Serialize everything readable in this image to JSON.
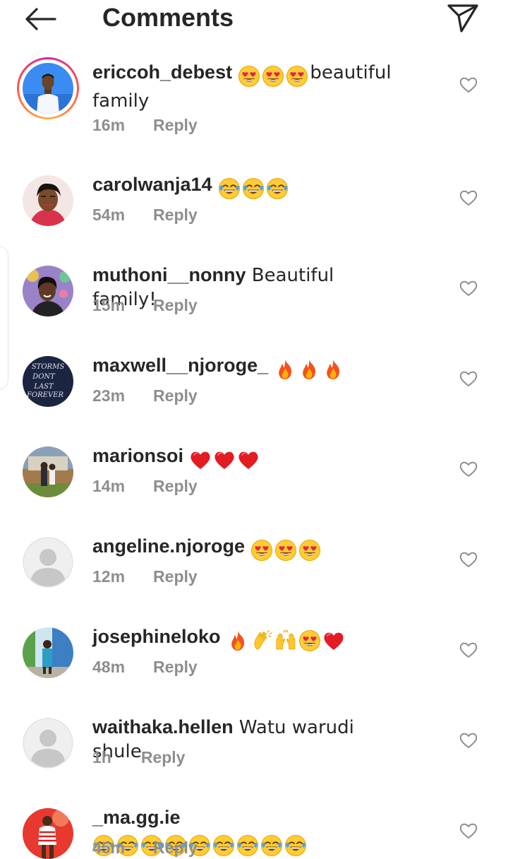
{
  "header": {
    "title": "Comments",
    "back_icon": "arrow-left-icon",
    "share_icon": "paper-plane-icon"
  },
  "comments": [
    {
      "username": "ericcoh_debest",
      "text": "beautiful family",
      "emojis": [
        "heart-eyes",
        "heart-eyes",
        "heart-eyes"
      ],
      "emoji_position": "before",
      "time": "16m",
      "reply": "Reply",
      "avatar": "photo-man-blue",
      "story_ring": true
    },
    {
      "username": "carolwanja14",
      "text": "",
      "emojis": [
        "tears-of-joy",
        "tears-of-joy",
        "tears-of-joy"
      ],
      "time": "54m",
      "reply": "Reply",
      "avatar": "photo-woman-selfie"
    },
    {
      "username": "muthoni__nonny",
      "text": "Beautiful family!",
      "emojis": [],
      "time": "15m",
      "reply": "Reply",
      "avatar": "photo-woman-purple"
    },
    {
      "username": "maxwell__njoroge_",
      "text": "",
      "emojis": [
        "fire",
        "fire",
        "fire"
      ],
      "time": "23m",
      "reply": "Reply",
      "avatar": "text-storms-dont-last-forever",
      "avatar_text": [
        "STORMS",
        "DONT",
        "LAST",
        "FOREVER"
      ]
    },
    {
      "username": "marionsoi",
      "text": "",
      "emojis": [
        "red-heart",
        "red-heart",
        "red-heart"
      ],
      "time": "14m",
      "reply": "Reply",
      "avatar": "photo-outdoor-people"
    },
    {
      "username": "angeline.njoroge",
      "text": "",
      "emojis": [
        "heart-eyes",
        "heart-eyes",
        "heart-eyes"
      ],
      "time": "12m",
      "reply": "Reply",
      "avatar": "default-avatar"
    },
    {
      "username": "josephineloko",
      "text": "",
      "emojis": [
        "fire",
        "clapping-hands",
        "raising-hands",
        "heart-eyes",
        "red-heart"
      ],
      "time": "48m",
      "reply": "Reply",
      "avatar": "photo-outdoor-woman"
    },
    {
      "username": "waithaka.hellen",
      "text": "Watu warudi shule",
      "emojis": [],
      "time": "1h",
      "reply": "Reply",
      "avatar": "default-avatar"
    },
    {
      "username": "_ma.gg.ie",
      "text": "",
      "emojis": [
        "tears-of-joy",
        "tears-of-joy",
        "tears-of-joy",
        "tears-of-joy",
        "tears-of-joy",
        "tears-of-joy",
        "tears-of-joy",
        "tears-of-joy",
        "tears-of-joy"
      ],
      "time": "45m",
      "reply": "Reply",
      "avatar": "photo-woman-red"
    }
  ],
  "colors": {
    "text": "#262626",
    "meta": "#8e8e8e",
    "icon": "#262626",
    "like_icon": "#8e8e8e"
  }
}
